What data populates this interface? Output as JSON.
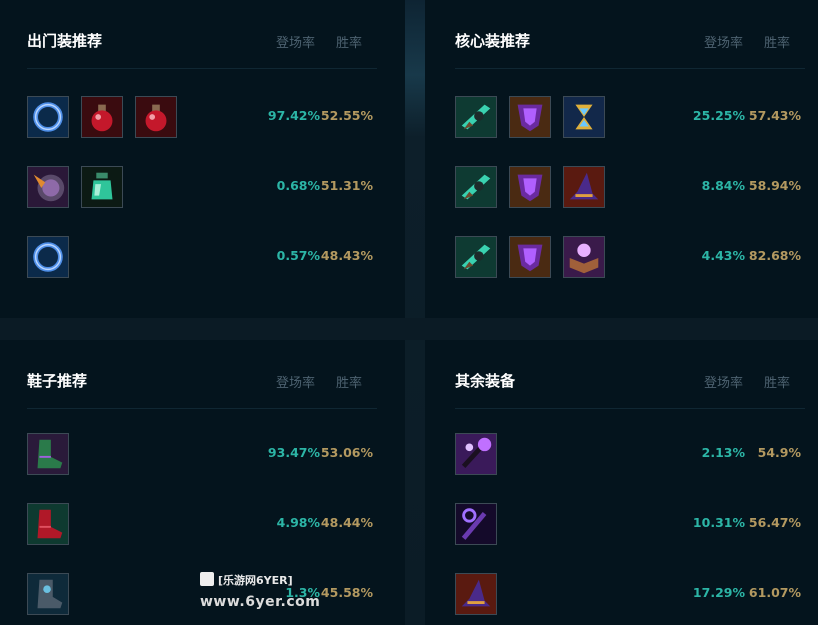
{
  "headers": {
    "pick_rate": "登场率",
    "win_rate": "胜率"
  },
  "starting": {
    "title": "出门装推荐",
    "rows": [
      {
        "items": [
          "ring-item-icon",
          "health-potion-icon",
          "health-potion-icon"
        ],
        "pick": "97.42%",
        "win": "52.55%"
      },
      {
        "items": [
          "purple-shield-item-icon",
          "green-potion-icon"
        ],
        "pick": "0.68%",
        "win": "51.31%"
      },
      {
        "items": [
          "ring-item-icon"
        ],
        "pick": "0.57%",
        "win": "48.43%"
      }
    ]
  },
  "core": {
    "title": "核心装推荐",
    "rows": [
      {
        "items": [
          "gunblade-item-icon",
          "purple-mask-item-icon",
          "hourglass-item-icon"
        ],
        "pick": "25.25%",
        "win": "57.43%"
      },
      {
        "items": [
          "gunblade-item-icon",
          "purple-mask-item-icon",
          "wizard-hat-item-icon"
        ],
        "pick": "8.84%",
        "win": "58.94%"
      },
      {
        "items": [
          "gunblade-item-icon",
          "purple-mask-item-icon",
          "spellbook-item-icon"
        ],
        "pick": "4.43%",
        "win": "82.68%"
      }
    ]
  },
  "boots": {
    "title": "鞋子推荐",
    "rows": [
      {
        "items": [
          "green-boots-icon"
        ],
        "pick": "93.47%",
        "win": "53.06%"
      },
      {
        "items": [
          "red-boots-icon"
        ],
        "pick": "4.98%",
        "win": "48.44%"
      },
      {
        "items": [
          "armored-boots-icon"
        ],
        "pick": "1.3%",
        "win": "45.58%"
      }
    ]
  },
  "other": {
    "title": "其余装备",
    "rows": [
      {
        "items": [
          "void-staff-item-icon"
        ],
        "pick": "2.13%",
        "win": "54.9%"
      },
      {
        "items": [
          "purple-staff-item-icon"
        ],
        "pick": "10.31%",
        "win": "56.47%"
      },
      {
        "items": [
          "wizard-hat-item-icon"
        ],
        "pick": "17.29%",
        "win": "61.07%"
      }
    ]
  },
  "watermark": {
    "top": "[乐游网6YER]",
    "bottom": "www.6yer.com"
  },
  "colors": {
    "pick_rate": "#2cb5a6",
    "win_rate": "#b39960",
    "panel_bg": "#04141d"
  }
}
